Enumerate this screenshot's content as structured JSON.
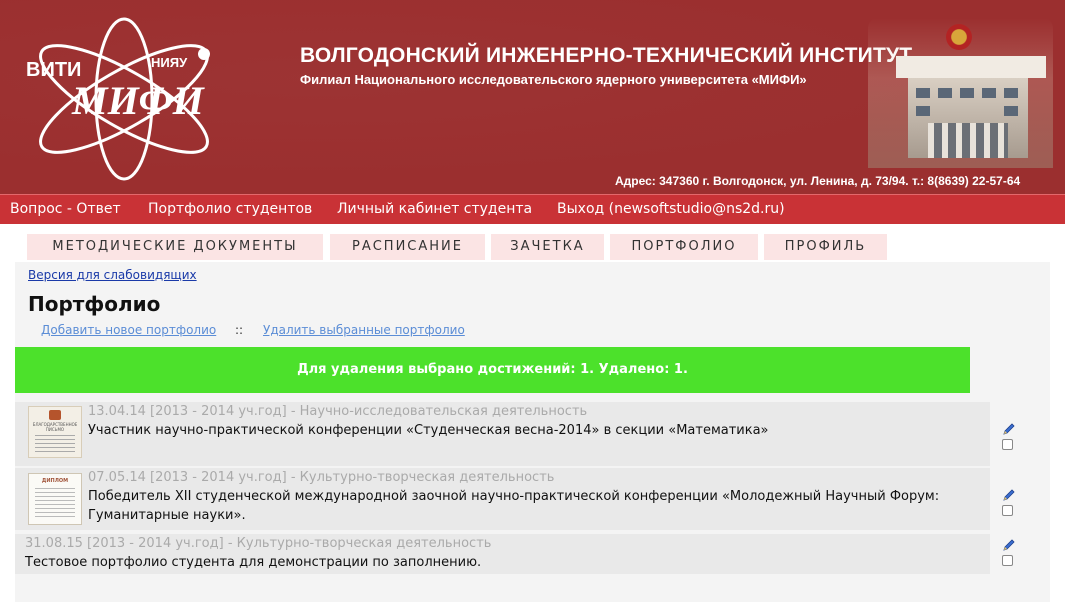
{
  "header": {
    "logo_left": "ВИТИ",
    "logo_right": "НИЯУ",
    "logo_main": "МИФИ",
    "title": "ВОЛГОДОНСКИЙ ИНЖЕНЕРНО-ТЕХНИЧЕСКИЙ ИНСТИТУТ",
    "subtitle": "Филиал Национального исследовательского ядерного университета «МИФИ»",
    "address": "Адрес: 347360 г. Волгодонск, ул. Ленина, д. 73/94. т.: 8(8639) 22-57-64",
    "brand_color": "#9b2f2f"
  },
  "topnav": {
    "items": [
      {
        "label": "Вопрос - Ответ"
      },
      {
        "label": "Портфолио студентов"
      },
      {
        "label": "Личный кабинет студента"
      },
      {
        "label": "Выход (newsoftstudio@ns2d.ru)"
      }
    ],
    "color": "#c93236"
  },
  "tabs": [
    {
      "label": "МЕТОДИЧЕСКИЕ ДОКУМЕНТЫ"
    },
    {
      "label": "РАСПИСАНИЕ"
    },
    {
      "label": "ЗАЧЕТКА"
    },
    {
      "label": "ПОРТФОЛИО"
    },
    {
      "label": "ПРОФИЛЬ"
    }
  ],
  "main": {
    "accessibility_link": "Версия для слабовидящих",
    "page_title": "Портфолио",
    "add_link": "Добавить новое портфолио",
    "separator": "::",
    "delete_link": "Удалить выбранные портфолио",
    "notice": "Для удаления выбрано достижений: 1. Удалено: 1.",
    "notice_color": "#4ce12b"
  },
  "entries": [
    {
      "meta": "13.04.14 [2013 - 2014 уч.год] - Научно-исследовательская деятельность",
      "description": "Участник научно-практической конференции «Студенческая весна-2014» в секции «Математика»",
      "thumb_title": "БЛАГОДАРСТВЕННОЕ ПИСЬМО",
      "has_thumbnail": true
    },
    {
      "meta": "07.05.14 [2013 - 2014 уч.год] - Культурно-творческая деятельность",
      "description": "Победитель XII студенческой международной заочной научно-практической конференции «Молодежный Научный Форум: Гуманитарные науки».",
      "thumb_title": "ДИПЛОМ",
      "has_thumbnail": true
    },
    {
      "meta": "31.08.15 [2013 - 2014 уч.год] - Культурно-творческая деятельность",
      "description": "Тестовое портфолио студента для демонстрации по заполнению.",
      "has_thumbnail": false
    }
  ]
}
